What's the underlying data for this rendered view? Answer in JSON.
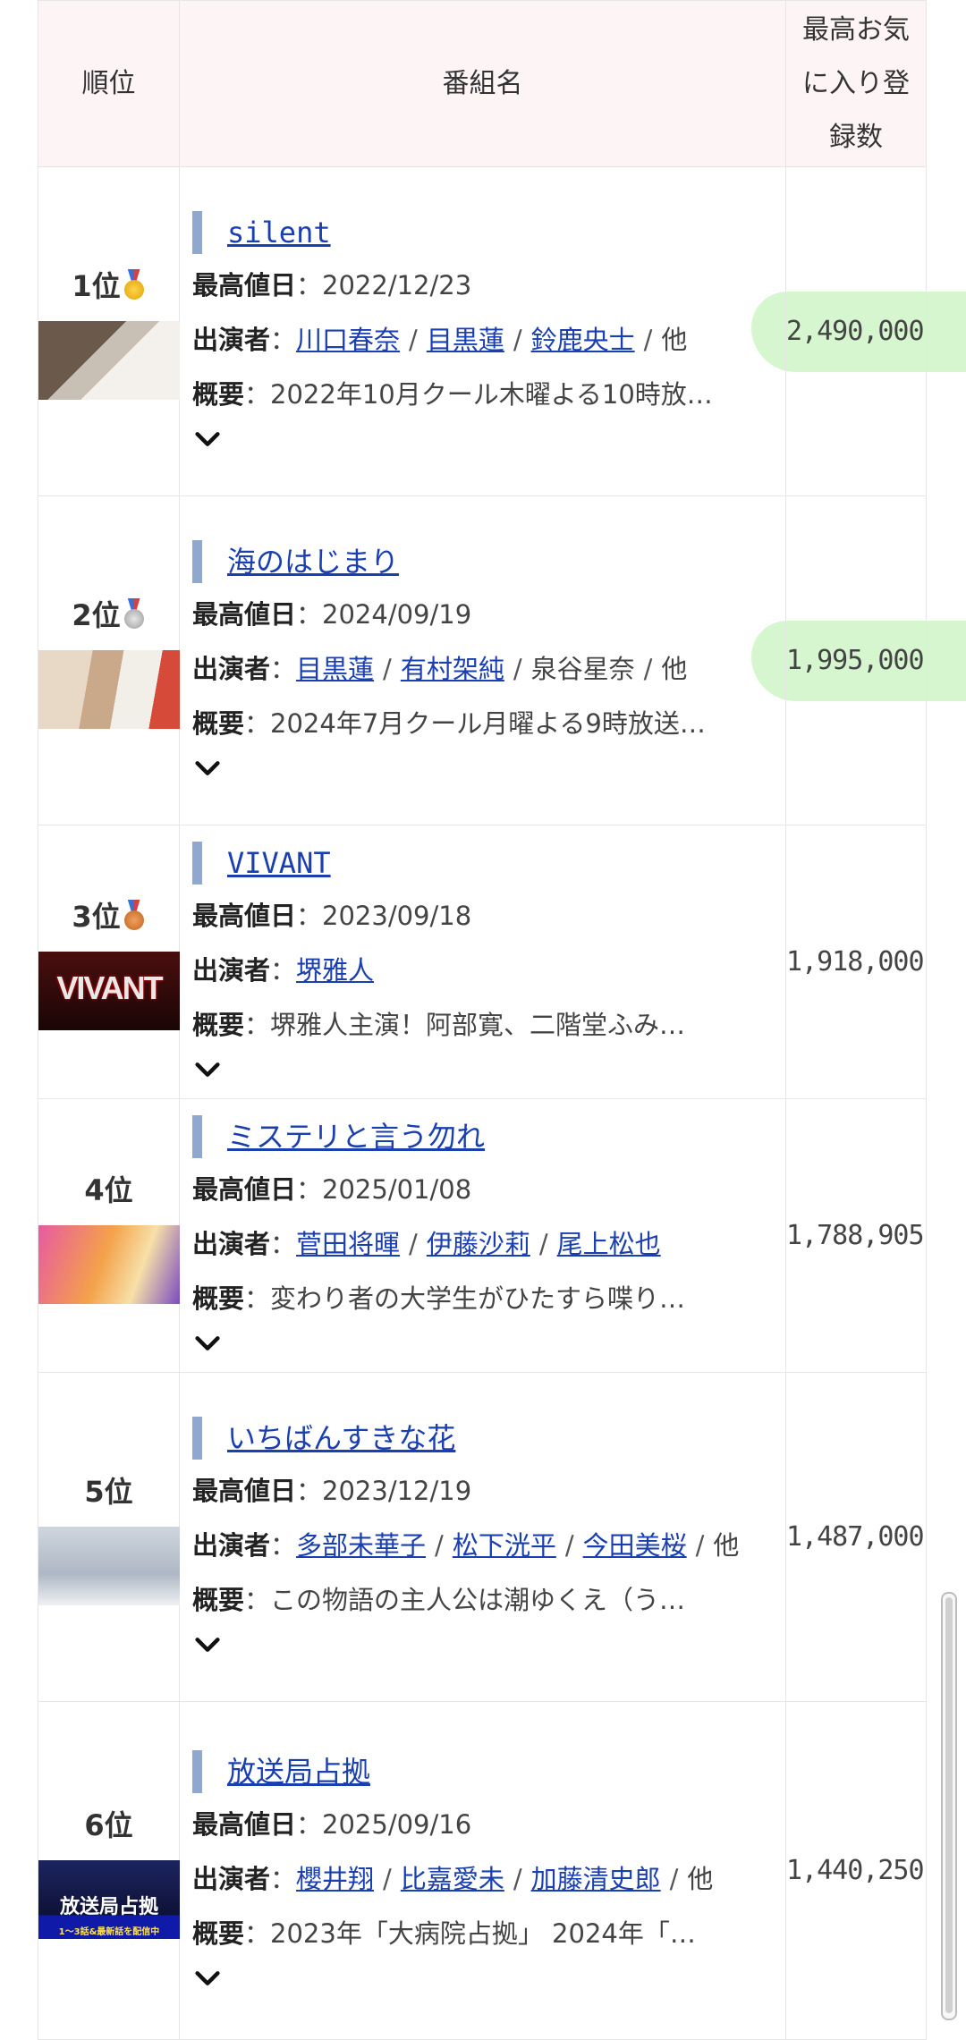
{
  "header": {
    "rank": "順位",
    "program": "番組名",
    "count": "最高お気に入り登録数"
  },
  "labels": {
    "peak_date": "最高値日",
    "cast": "出演者",
    "summary": "概要",
    "colon": "：",
    "sep": "/",
    "others": "他"
  },
  "rows": [
    {
      "rank": "1位",
      "medal": "gold",
      "title": "silent",
      "title_mono": true,
      "date": "2022/12/23",
      "cast": [
        "川口春奈",
        "目黒蓮",
        "鈴鹿央士"
      ],
      "cast_linked": [
        true,
        true,
        true
      ],
      "others": true,
      "summary": "2022年10月クール木曜よる10時放…",
      "count": "2,490,000",
      "highlight": true
    },
    {
      "rank": "2位",
      "medal": "silver",
      "title": "海のはじまり",
      "title_mono": false,
      "date": "2024/09/19",
      "cast": [
        "目黒蓮",
        "有村架純",
        "泉谷星奈"
      ],
      "cast_linked": [
        true,
        true,
        false
      ],
      "others": true,
      "summary": "2024年7月クール月曜よる9時放送…",
      "count": "1,995,000",
      "highlight": true
    },
    {
      "rank": "3位",
      "medal": "bronze",
      "title": "VIVANT",
      "title_mono": true,
      "date": "2023/09/18",
      "cast": [
        "堺雅人"
      ],
      "cast_linked": [
        true
      ],
      "others": false,
      "summary": "堺雅人主演！阿部寛、二階堂ふみ…",
      "count": "1,918,000",
      "highlight": false,
      "thumb_text": "VIVANT"
    },
    {
      "rank": "4位",
      "medal": "",
      "title": "ミステリと言う勿れ",
      "title_mono": false,
      "date": "2025/01/08",
      "cast": [
        "菅田将暉",
        "伊藤沙莉",
        "尾上松也"
      ],
      "cast_linked": [
        true,
        true,
        true
      ],
      "others": false,
      "summary": "変わり者の大学生がひたすら喋り…",
      "count": "1,788,905",
      "highlight": false
    },
    {
      "rank": "5位",
      "medal": "",
      "title": "いちばんすきな花",
      "title_mono": false,
      "date": "2023/12/19",
      "cast": [
        "多部未華子",
        "松下洸平",
        "今田美桜"
      ],
      "cast_linked": [
        true,
        true,
        true
      ],
      "others": true,
      "summary": "この物語の主人公は潮ゆくえ（う…",
      "count": "1,487,000",
      "highlight": false
    },
    {
      "rank": "6位",
      "medal": "",
      "title": "放送局占拠",
      "title_mono": false,
      "date": "2025/09/16",
      "cast": [
        "櫻井翔",
        "比嘉愛未",
        "加藤清史郎"
      ],
      "cast_linked": [
        true,
        true,
        true
      ],
      "others": true,
      "summary": "2023年「大病院占拠」 2024年「…",
      "count": "1,440,250",
      "highlight": false,
      "thumb_text": "放送局占拠",
      "thumb_sub": "1〜3話&最新話を配信中"
    }
  ],
  "colors": {
    "link": "#1a3fb0",
    "header_bg": "#fdf4f6",
    "accent_bar": "#8fa8cf",
    "highlight": "#c8f3c0"
  }
}
